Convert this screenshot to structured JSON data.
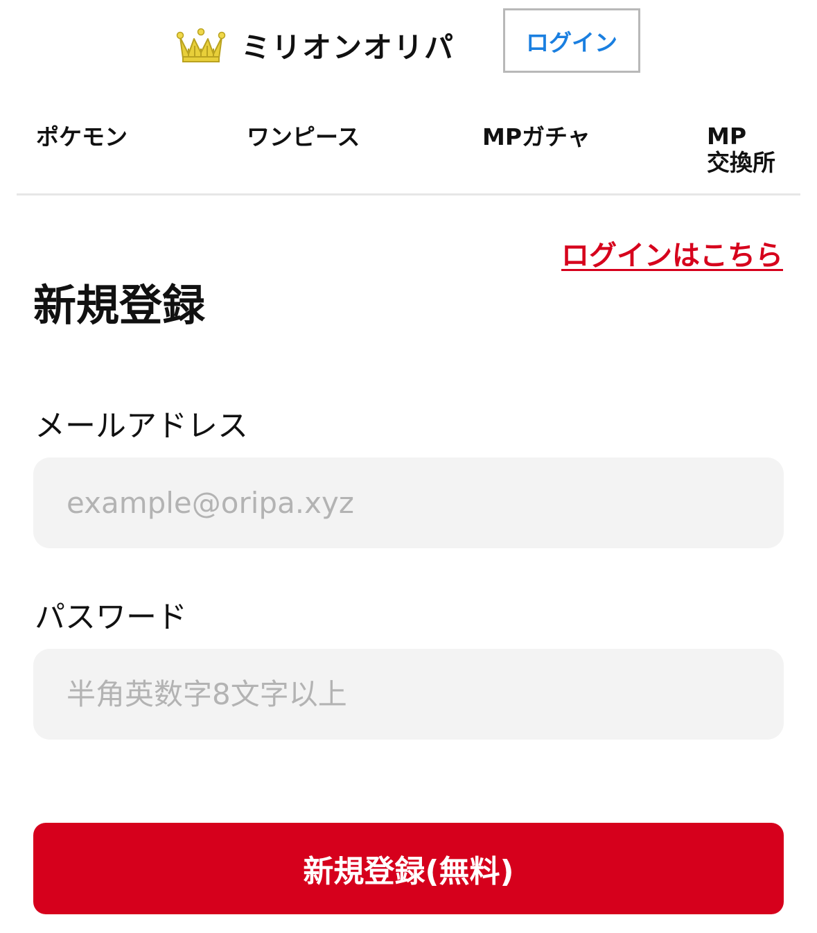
{
  "header": {
    "brand_name": "ミリオンオリパ",
    "logo_icon": "crown-icon",
    "login_button": "ログイン"
  },
  "nav": {
    "items": [
      {
        "label": "ポケモン"
      },
      {
        "label": "ワンピース"
      },
      {
        "label": "MPガチャ"
      },
      {
        "label_line1": "MP",
        "label_line2": "交換所"
      }
    ]
  },
  "main": {
    "login_link": "ログインはこちら",
    "title": "新規登録",
    "email": {
      "label": "メールアドレス",
      "placeholder": "example@oripa.xyz",
      "value": ""
    },
    "password": {
      "label": "パスワード",
      "placeholder": "半角英数字8文字以上",
      "value": ""
    },
    "submit_label": "新規登録(無料)"
  },
  "colors": {
    "accent_red": "#d6001c",
    "link_blue": "#1a7fe0",
    "crown_gold": "#e8cf3a",
    "input_bg": "#f3f3f3"
  }
}
